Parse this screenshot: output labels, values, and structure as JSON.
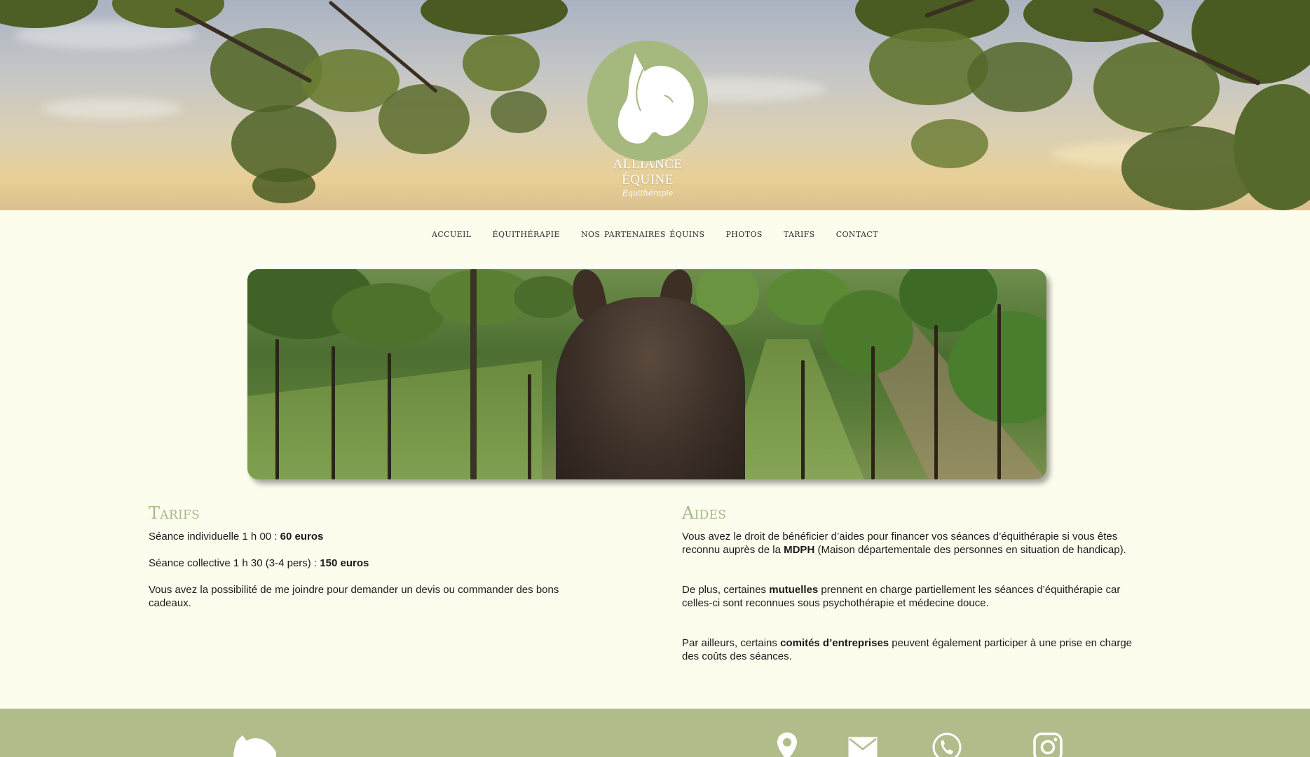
{
  "header": {
    "logo_title": "ALLIANCE ÉQUINE",
    "logo_subtitle": "Équithérapie"
  },
  "nav": {
    "items": [
      "ACCUEIL",
      "ÉQUITHÉRAPIE",
      "NOS PARTENAIRES ÉQUINS",
      "PHOTOS",
      "TARIFS",
      "CONTACT"
    ]
  },
  "tarifs": {
    "title": "Tarifs",
    "line1_text": "Séance individuelle 1 h 00 : ",
    "line1_price": "60 euros",
    "line2_text": "Séance collective 1 h 30 (3-4 pers) : ",
    "line2_price": "150 euros",
    "line3_text": "Vous avez la possibilité de me joindre pour demander un devis ou commander des bons cadeaux."
  },
  "aides": {
    "title": "Aides",
    "p1_a": "Vous avez le droit de bénéficier d’aides pour financer vos séances d’équithérapie si vous êtes reconnu auprès de la ",
    "p1_b": "MDPH",
    "p1_c": " (Maison départementale des personnes en situation de handicap).",
    "p2_a": "De plus, certaines ",
    "p2_b": "mutuelles",
    "p2_c": " prennent en charge partiellement les séances d’équithérapie car celles-ci sont reconnues sous psychothérapie et médecine douce.",
    "p3_a": "Par ailleurs, certains ",
    "p3_b": "comités d’entreprises",
    "p3_c": " peuvent également participer à une prise en charge des coûts des séances."
  },
  "footer": {
    "icons": [
      "horse-logo-icon",
      "location-pin-icon",
      "mail-icon",
      "phone-icon",
      "instagram-icon"
    ]
  },
  "colors": {
    "accent_green": "#a8b985",
    "footer_green": "#b0bd8b",
    "page_bg": "#fdfdee"
  }
}
